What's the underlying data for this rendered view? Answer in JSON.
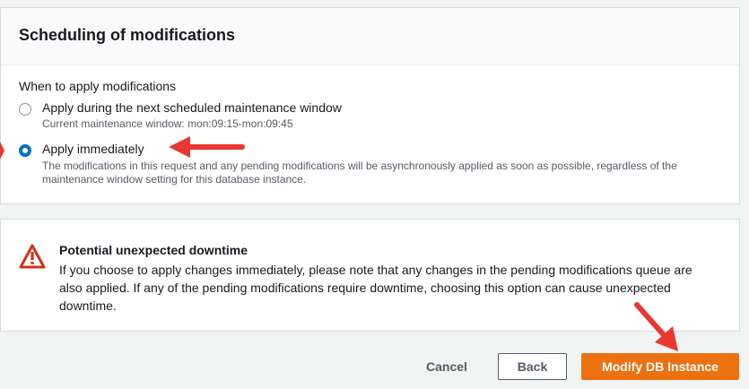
{
  "scheduling": {
    "title": "Scheduling of modifications",
    "field_label": "When to apply modifications",
    "options": [
      {
        "label": "Apply during the next scheduled maintenance window",
        "description": "Current maintenance window: mon:09:15-mon:09:45",
        "selected": false
      },
      {
        "label": "Apply immediately",
        "description_line1": "The modifications in this request and any pending modifications will be asynchronously applied as soon as possible, regardless of the",
        "description_line2": "maintenance window setting for this database instance.",
        "selected": true
      }
    ]
  },
  "alert": {
    "title": "Potential unexpected downtime",
    "body": "If you choose to apply changes immediately, please note that any changes in the pending modifications queue are also applied. If any of the pending modifications require downtime, choosing this option can cause unexpected downtime.",
    "icon": "warning-icon",
    "icon_color": "#d13212"
  },
  "actions": {
    "cancel_label": "Cancel",
    "back_label": "Back",
    "modify_label": "Modify DB Instance"
  },
  "colors": {
    "primary": "#ec7211",
    "radio_selected": "#0073bb",
    "annotation_arrow": "#e8382f"
  }
}
